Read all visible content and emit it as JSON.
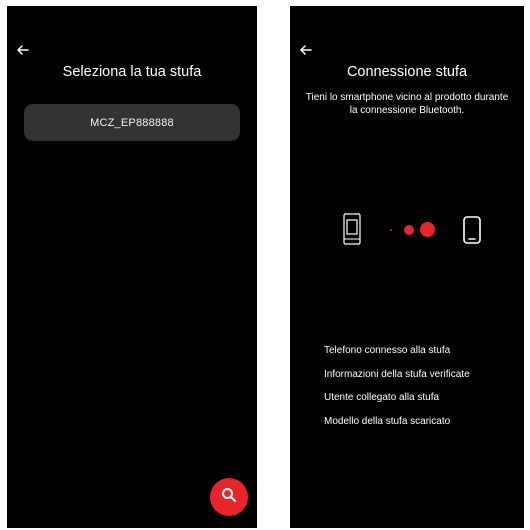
{
  "left_screen": {
    "title": "Seleziona la tua stufa",
    "stoves": [
      {
        "name": "MCZ_EP888888"
      }
    ],
    "colors": {
      "accent": "#e8252c",
      "item_bg": "#333333",
      "background": "#000000"
    },
    "icons": {
      "back": "arrow-left-icon",
      "fab": "search-icon"
    }
  },
  "right_screen": {
    "title": "Connessione stufa",
    "subtitle_line1": "Tieni lo smartphone vicino al prodotto durante",
    "subtitle_line2": "la connessione Bluetooth.",
    "icons": {
      "back": "arrow-left-icon",
      "stove": "stove-icon",
      "phone": "smartphone-icon"
    },
    "steps": [
      "Telefono connesso alla stufa",
      "Informazioni della stufa verificate",
      "Utente collegato alla stufa",
      "Modello della stufa scaricato"
    ]
  }
}
